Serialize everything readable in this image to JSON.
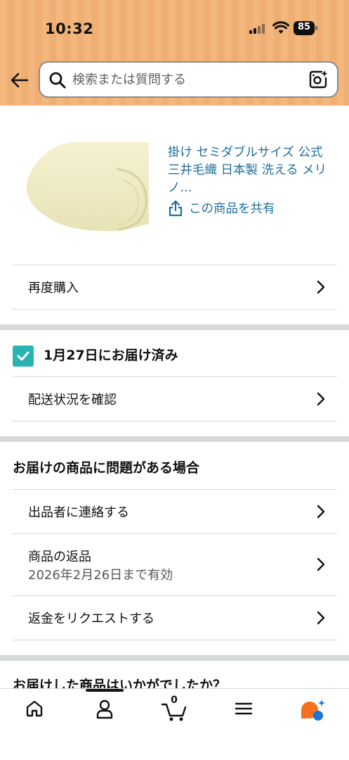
{
  "status": {
    "time": "10:32",
    "battery": "85"
  },
  "search": {
    "placeholder": "検索または質問する"
  },
  "product": {
    "title": "掛け セミダブルサイズ 公式 三井毛織 日本製 洗える メリノ...",
    "share_label": "この商品を共有"
  },
  "actions": {
    "buy_again": "再度購入"
  },
  "delivery": {
    "status": "1月27日にお届け済み",
    "track": "配送状況を確認"
  },
  "problem": {
    "title": "お届けの商品に問題がある場合",
    "contact_seller": "出品者に連絡する",
    "return_label": "商品の返品",
    "return_valid": "2026年2月26日まで有効",
    "refund": "返金をリクエストする"
  },
  "review": {
    "title": "お届けした商品はいかがでしたか？"
  },
  "nav": {
    "cart_count": "0"
  },
  "colors": {
    "header": "#f3b77e",
    "link": "#1f6f9f",
    "check": "#2bb3b1",
    "separator": "#d5d9d9"
  }
}
